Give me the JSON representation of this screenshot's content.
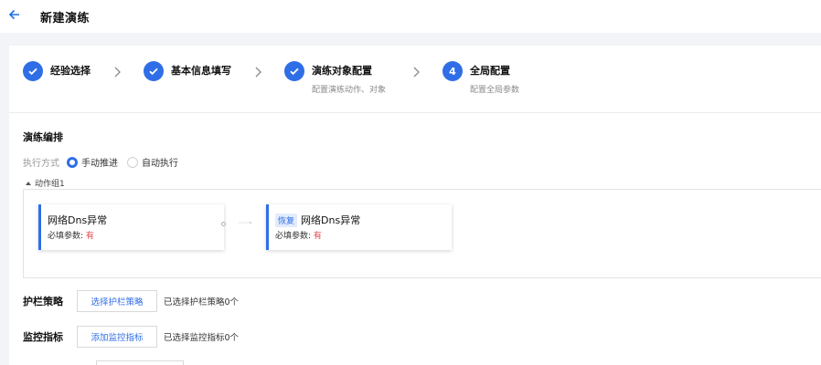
{
  "header": {
    "title": "新建演练"
  },
  "steps": [
    {
      "label": "经验选择",
      "desc": "",
      "state": "done"
    },
    {
      "label": "基本信息填写",
      "desc": "",
      "state": "done"
    },
    {
      "label": "演练对象配置",
      "desc": "配置演练动作、对象",
      "state": "done"
    },
    {
      "label": "全局配置",
      "desc": "配置全局参数",
      "state": "active",
      "number": "4"
    }
  ],
  "orchestration": {
    "title": "演练编排",
    "exec_mode_label": "执行方式",
    "options": [
      "手动推进",
      "自动执行"
    ],
    "selected": "手动推进",
    "group_label": "动作组1",
    "nodes": [
      {
        "title": "网络Dns异常",
        "tag": "",
        "param_label": "必填参数:",
        "param_value": "有"
      },
      {
        "title": "网络Dns异常",
        "tag": "恢复",
        "param_label": "必填参数:",
        "param_value": "有"
      }
    ]
  },
  "guardrail": {
    "label": "护栏策略",
    "button": "选择护栏策略",
    "note": "已选择护栏策略0个"
  },
  "monitor": {
    "label": "监控指标",
    "button": "添加监控指标",
    "note": "已选择监控指标0个"
  },
  "colors": {
    "accent": "#2f6ee6",
    "danger": "#e5484d"
  }
}
